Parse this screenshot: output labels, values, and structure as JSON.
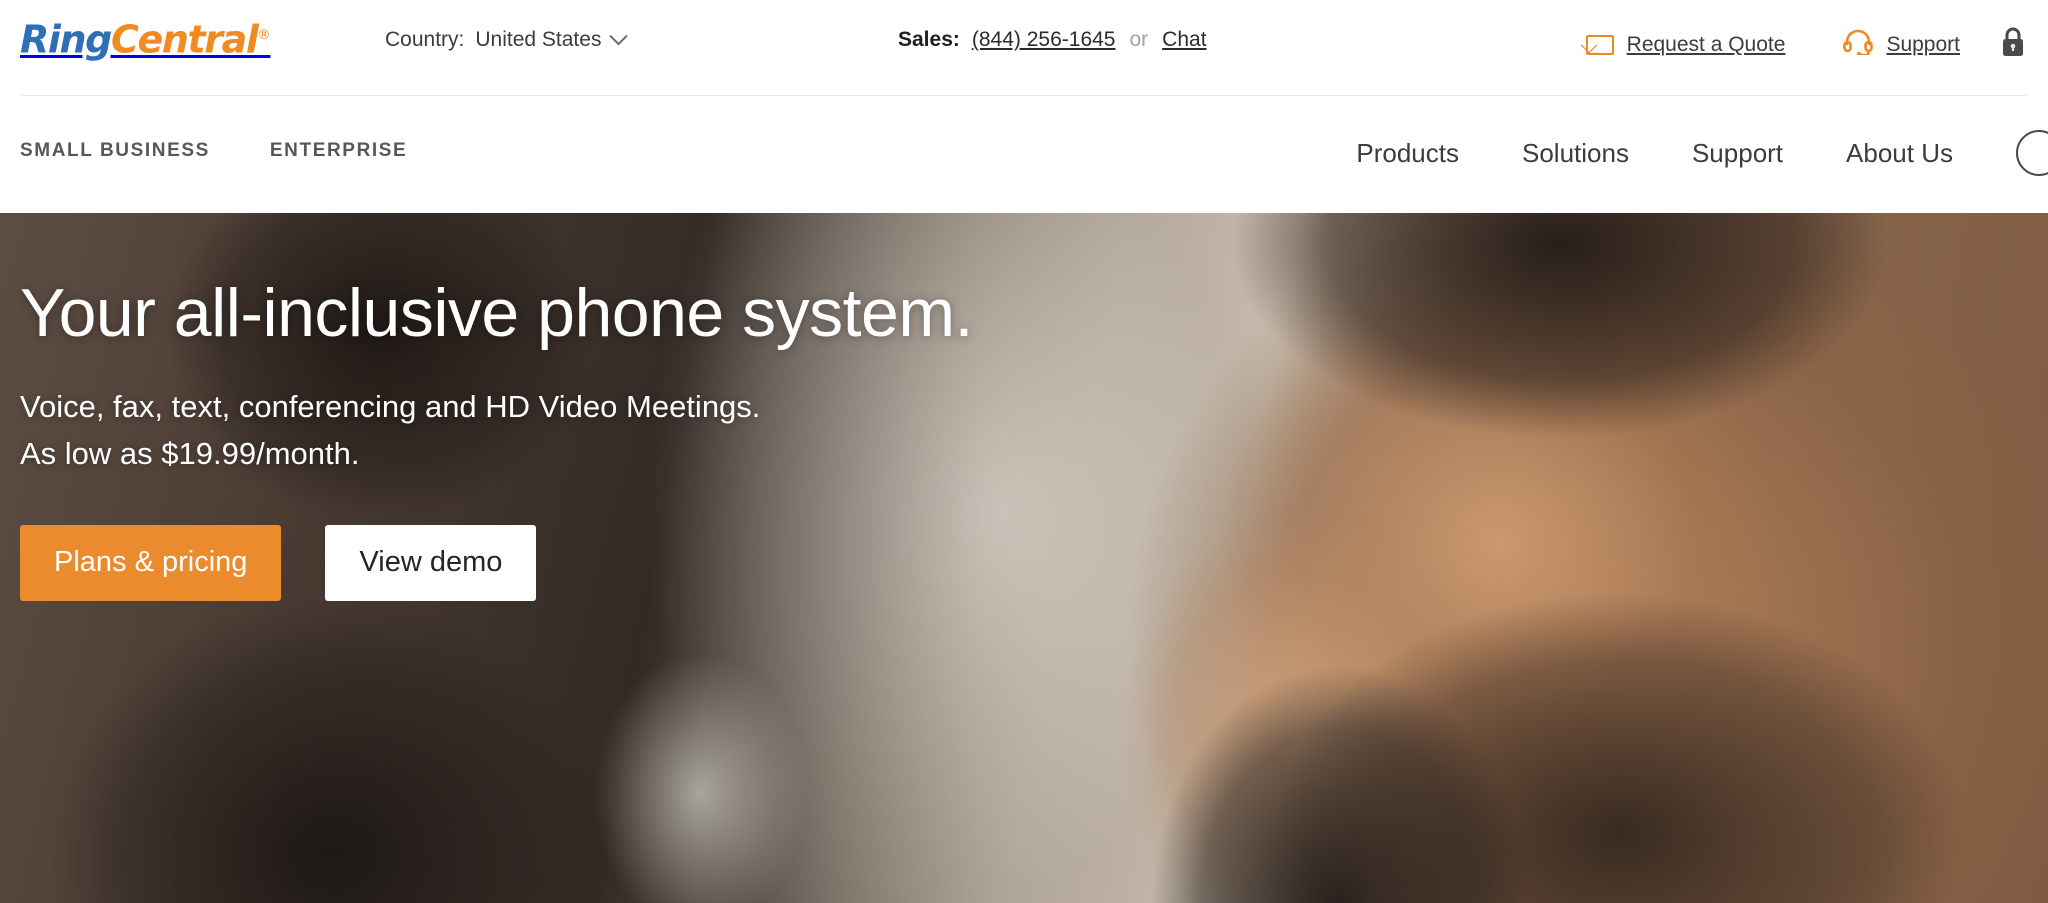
{
  "brand": {
    "logo_ring": "Ring",
    "logo_central": "Central",
    "logo_registered": "®",
    "color_blue": "#2f6fb5",
    "color_orange": "#f08a22",
    "accent_orange": "#ea8b2d"
  },
  "topbar": {
    "country": {
      "label": "Country:",
      "value": "United States",
      "chevron_icon": "chevron-down-icon"
    },
    "sales": {
      "label": "Sales:",
      "phone": "(844) 256-1645",
      "separator": "or",
      "chat": "Chat"
    },
    "links": [
      {
        "label": "Request a Quote",
        "icon": "envelope-icon"
      },
      {
        "label": "Support",
        "icon": "headset-icon"
      }
    ],
    "lock_icon": "lock-icon"
  },
  "mainnav": {
    "segments": [
      {
        "label": "Small Business"
      },
      {
        "label": "Enterprise"
      }
    ],
    "links": [
      {
        "label": "Products"
      },
      {
        "label": "Solutions"
      },
      {
        "label": "Support"
      },
      {
        "label": "About Us"
      }
    ],
    "search_icon": "search-icon"
  },
  "hero": {
    "title": "Your all-inclusive phone system.",
    "subtitle_line1": "Voice, fax, text, conferencing and HD Video Meetings.",
    "subtitle_line2": "As low as $19.99/month.",
    "primary_button": "Plans & pricing",
    "secondary_button": "View demo"
  }
}
